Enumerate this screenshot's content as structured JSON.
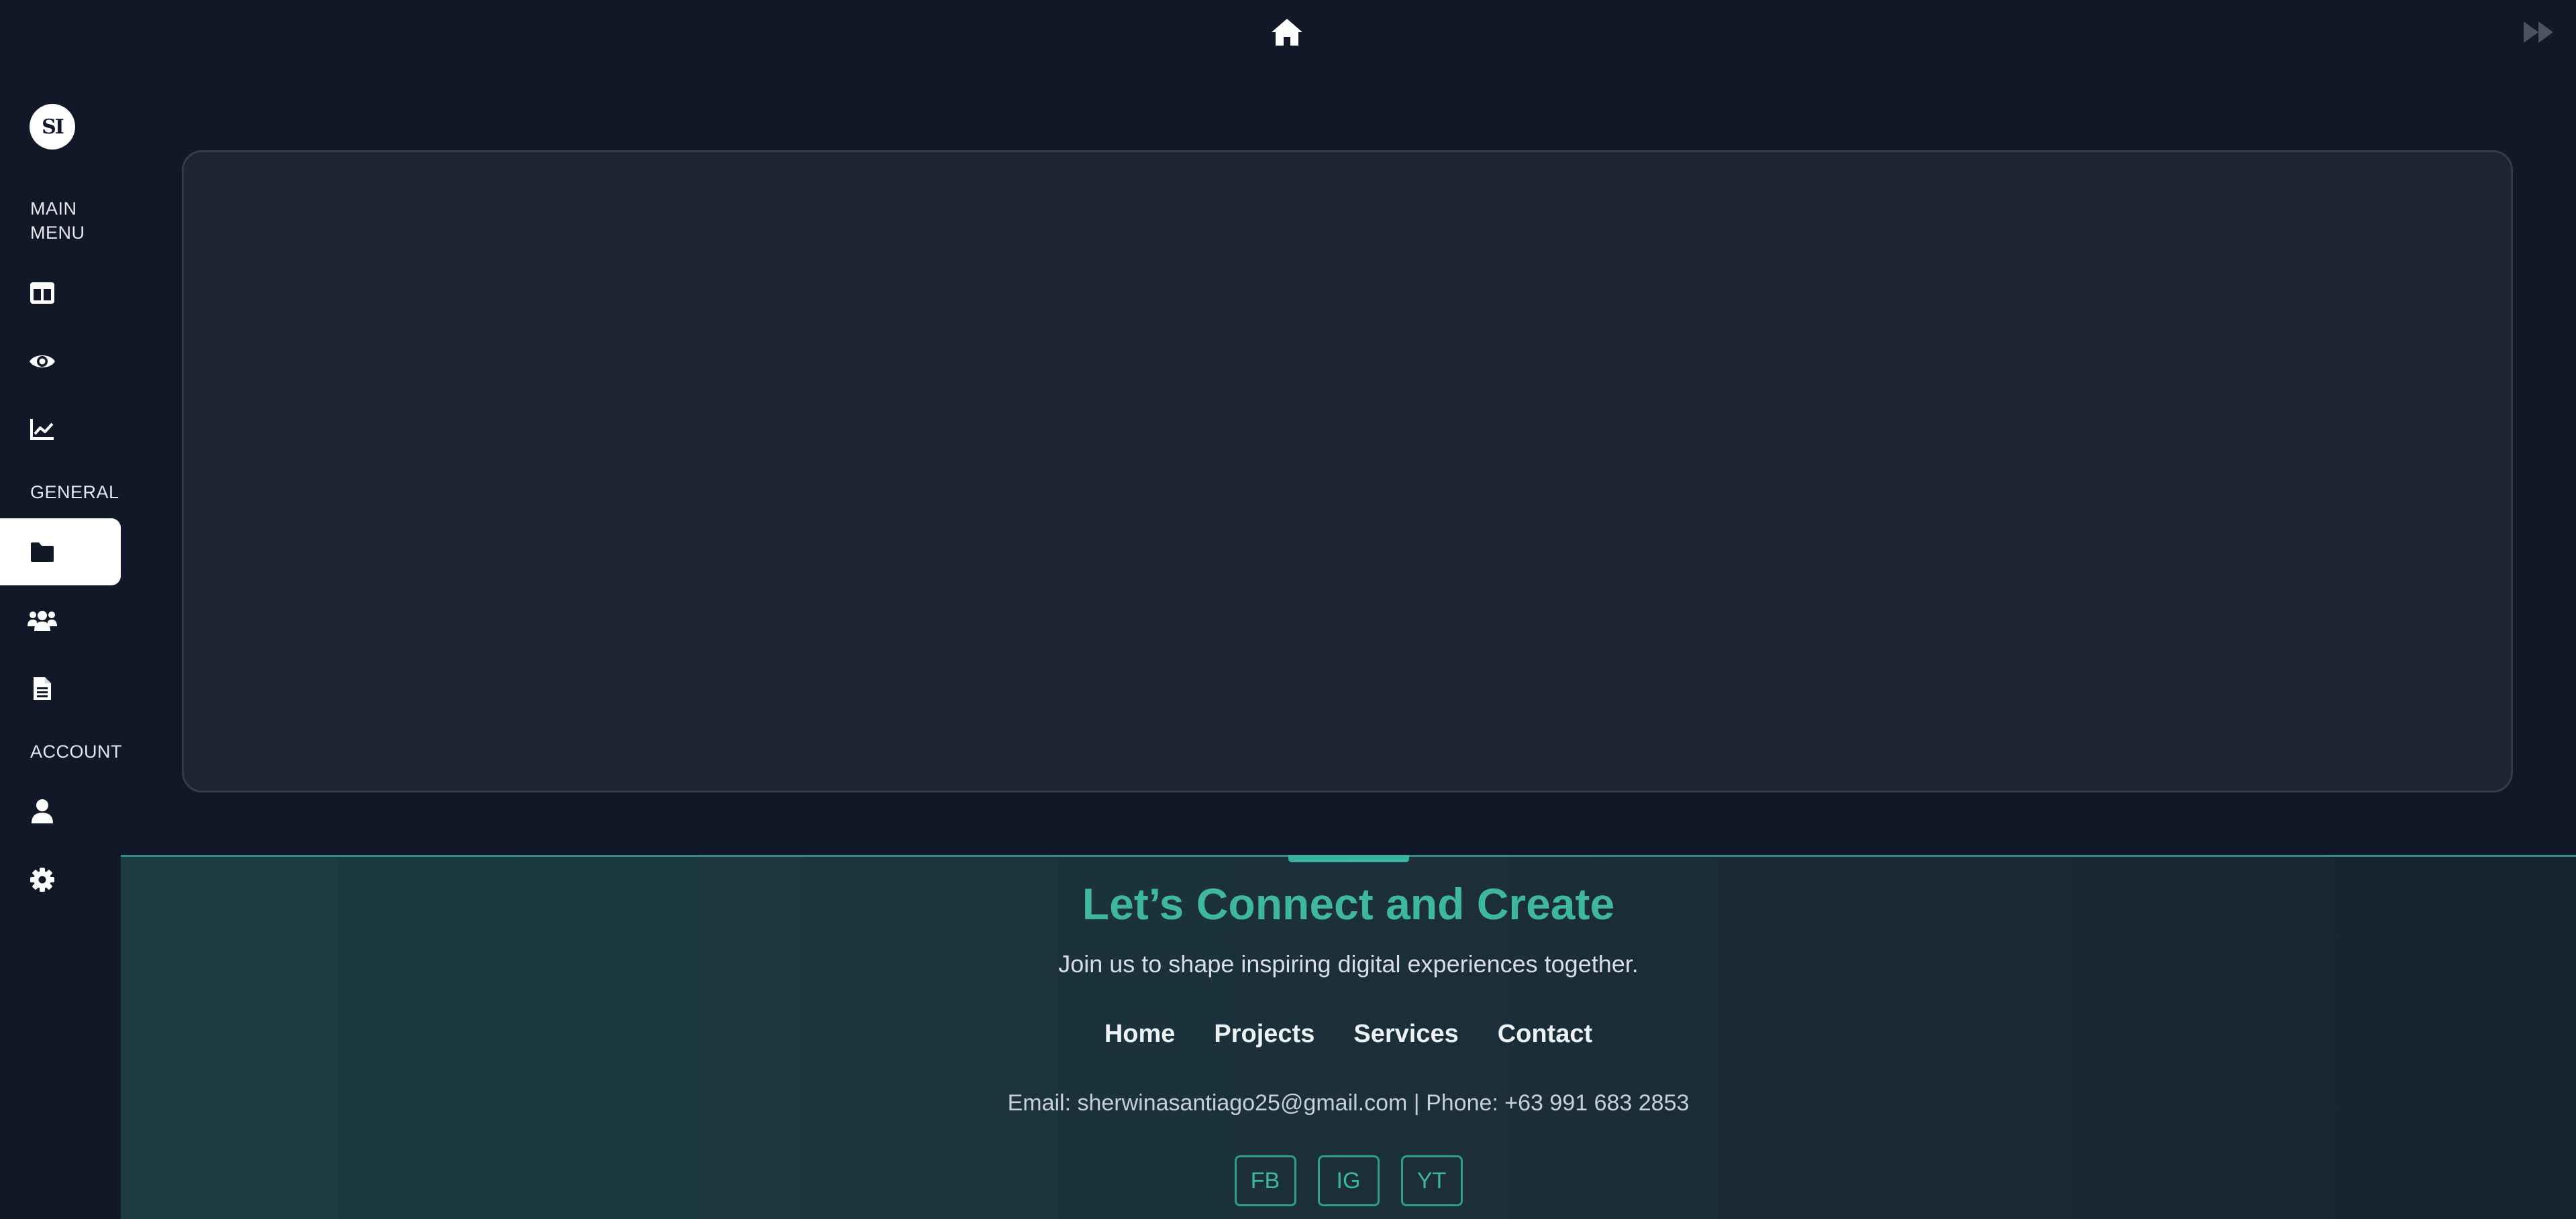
{
  "topbar": {
    "prev_icon": "rewind-icon",
    "home_icon": "home-icon",
    "next_icon": "fast-forward-icon"
  },
  "sidebar": {
    "logo_text": "SI",
    "sections": {
      "main_menu": "MAIN MENU",
      "general": "GENERAL",
      "account": "ACCOUNT"
    },
    "items": [
      {
        "icon": "dashboard-icon",
        "active": false
      },
      {
        "icon": "eye-icon",
        "active": false
      },
      {
        "icon": "line-chart-icon",
        "active": false
      },
      {
        "icon": "folder-icon",
        "active": true
      },
      {
        "icon": "users-icon",
        "active": false
      },
      {
        "icon": "document-icon",
        "active": false
      },
      {
        "icon": "user-icon",
        "active": false
      },
      {
        "icon": "gear-icon",
        "active": false
      }
    ]
  },
  "footer": {
    "title": "Let’s Connect and Create",
    "subtitle": "Join us to shape inspiring digital experiences together.",
    "links": [
      "Home",
      "Projects",
      "Services",
      "Contact"
    ],
    "contact": "Email: sherwinasantiago25@gmail.com | Phone: +63 991 683 2853",
    "social": [
      "FB",
      "IG",
      "YT"
    ]
  },
  "colors": {
    "background": "#111827",
    "card": "#1f2432",
    "accent": "#3fb79e",
    "active_item": "#ffffff"
  }
}
